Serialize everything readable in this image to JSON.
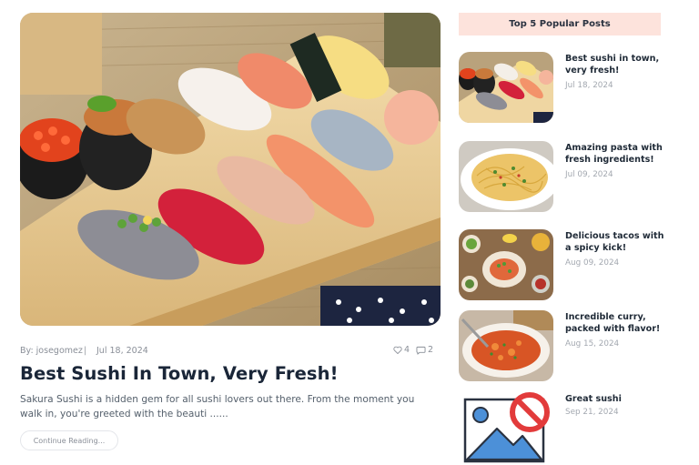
{
  "main_post": {
    "author": "By: josegomez",
    "separator": "|",
    "date": "Jul 18, 2024",
    "likes": "4",
    "comments": "2",
    "title": "Best Sushi In Town, Very Fresh!",
    "excerpt": "Sakura Sushi is a hidden gem for all sushi lovers out there. From the moment you walk in, you're greeted with the beauti ......",
    "continue_label": "Continue Reading..."
  },
  "sidebar": {
    "heading": "Top 5 Popular Posts",
    "posts": [
      {
        "title": "Best sushi in town, very fresh!",
        "date": "Jul 18, 2024",
        "thumb": "sushi"
      },
      {
        "title": "Amazing pasta with fresh ingredients!",
        "date": "Jul 09, 2024",
        "thumb": "pasta"
      },
      {
        "title": "Delicious tacos with a spicy kick!",
        "date": "Aug 09, 2024",
        "thumb": "tacos"
      },
      {
        "title": "Incredible curry, packed with flavor!",
        "date": "Aug 15, 2024",
        "thumb": "curry"
      },
      {
        "title": "Great sushi",
        "date": "Sep 21, 2024",
        "thumb": "image-unavailable"
      }
    ]
  },
  "colors": {
    "heading_bg": "#fde3dc",
    "title": "#1a2638",
    "muted": "#8a8f98",
    "placeholder_red": "#e23b3b",
    "placeholder_blue": "#4c90d8"
  }
}
